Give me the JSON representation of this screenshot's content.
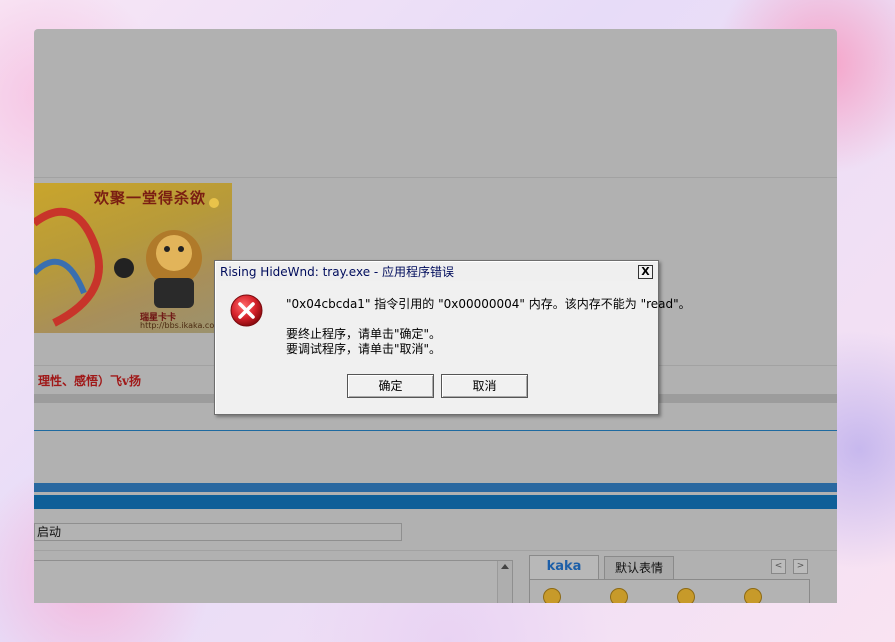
{
  "background_page": {
    "banner": {
      "title": "欢聚一堂得杀欲",
      "brand": "瑞星卡卡",
      "url": "http://bbs.ikaka.co"
    },
    "red_text": "理性、感悟）飞v扬",
    "start_field_value": "启动",
    "tabs": [
      {
        "label": "kaka",
        "active": true
      },
      {
        "label": "默认表情",
        "active": false
      }
    ],
    "tab_nav": {
      "prev": "<",
      "next": ">"
    }
  },
  "dialog": {
    "title": "Rising HideWnd: tray.exe - 应用程序错误",
    "close_label": "X",
    "icon": "error-icon",
    "message_line1": "\"0x04cbcda1\" 指令引用的 \"0x00000004\" 内存。该内存不能为 \"read\"。",
    "message_line2": "要终止程序，请单击\"确定\"。",
    "message_line3": "要调试程序，请单击\"取消\"。",
    "ok_label": "确定",
    "cancel_label": "取消"
  },
  "colors": {
    "overlay": "#b1b1b1",
    "dialog_bg": "#f0f0f0",
    "title_text": "#000c5c",
    "error_red": "#d6222b",
    "tab_active_text": "#1d5fa8"
  }
}
